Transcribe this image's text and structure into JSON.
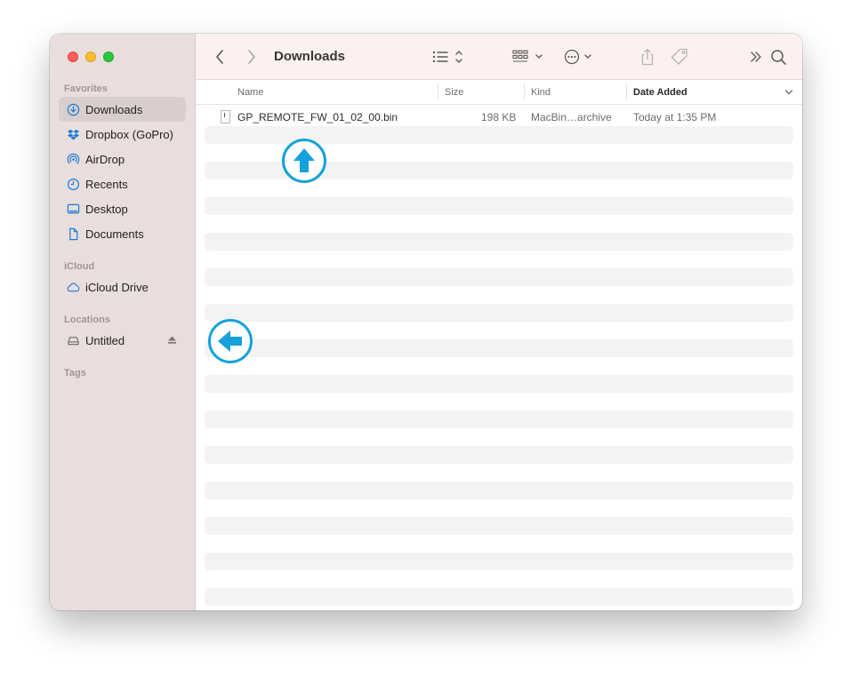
{
  "window": {
    "title": "Downloads"
  },
  "sidebar": {
    "sections": [
      {
        "label": "Favorites"
      },
      {
        "label": "iCloud"
      },
      {
        "label": "Locations"
      },
      {
        "label": "Tags"
      }
    ],
    "favorites": [
      {
        "label": "Downloads",
        "icon": "download-circle-icon",
        "active": true
      },
      {
        "label": "Dropbox (GoPro)",
        "icon": "dropbox-icon"
      },
      {
        "label": "AirDrop",
        "icon": "airdrop-icon"
      },
      {
        "label": "Recents",
        "icon": "clock-icon"
      },
      {
        "label": "Desktop",
        "icon": "desktop-icon"
      },
      {
        "label": "Documents",
        "icon": "document-icon"
      }
    ],
    "icloud": [
      {
        "label": "iCloud Drive",
        "icon": "cloud-icon"
      }
    ],
    "locations": [
      {
        "label": "Untitled",
        "icon": "drive-icon"
      }
    ]
  },
  "columns": {
    "name": "Name",
    "size": "Size",
    "kind": "Kind",
    "date_added": "Date Added"
  },
  "files": [
    {
      "name": "GP_REMOTE_FW_01_02_00.bin",
      "size": "198 KB",
      "kind": "MacBin…archive",
      "date_added": "Today at 1:35 PM"
    }
  ],
  "colors": {
    "sidebar_bg": "#e8dedd",
    "toolbar_bg": "#fbf1f0",
    "accent_arrow": "#14a1dc",
    "sidebar_icon": "#1f7ad6"
  }
}
